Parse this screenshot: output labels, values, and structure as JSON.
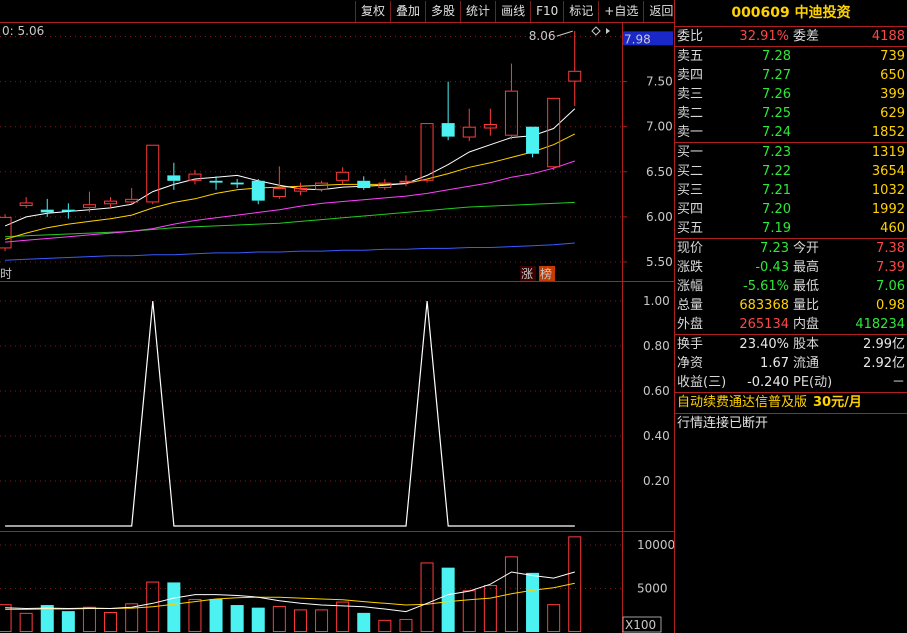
{
  "toolbar": {
    "buttons": [
      "复权",
      "叠加",
      "多股",
      "统计",
      "画线",
      "F10",
      "标记",
      "+自选",
      "返回"
    ]
  },
  "chart": {
    "ma_label": "0: 5.06",
    "price_tag": "7.98",
    "high_marker": "8.06",
    "badge_zhang": "涨",
    "badge_bang": "榜",
    "corner_char": "时",
    "vol_unit": "X100",
    "colors": {
      "up": "#ff3c3c",
      "down": "#4cf2f2",
      "ma5": "#ffffff",
      "ma10": "#ffd200",
      "ma20": "#ff40ff",
      "ma60": "#22cc22",
      "ma120": "#3b5bff",
      "grid": "#7a1d1d"
    }
  },
  "chart_data": [
    {
      "type": "candlestick",
      "title": "",
      "y_ticks": [
        "7.50",
        "7.00",
        "6.50",
        "6.00",
        "5.50"
      ],
      "ylim": [
        5.3,
        8.15
      ],
      "candles": [
        {
          "o": 5.65,
          "c": 6.0,
          "h": 6.03,
          "l": 5.62
        },
        {
          "o": 6.12,
          "c": 6.16,
          "h": 6.22,
          "l": 6.1
        },
        {
          "o": 6.08,
          "c": 6.05,
          "h": 6.2,
          "l": 6.0
        },
        {
          "o": 6.08,
          "c": 6.06,
          "h": 6.15,
          "l": 5.98
        },
        {
          "o": 6.1,
          "c": 6.14,
          "h": 6.28,
          "l": 6.05
        },
        {
          "o": 6.14,
          "c": 6.18,
          "h": 6.22,
          "l": 6.1
        },
        {
          "o": 6.16,
          "c": 6.2,
          "h": 6.32,
          "l": 6.14
        },
        {
          "o": 6.16,
          "c": 6.8,
          "h": 6.8,
          "l": 6.14
        },
        {
          "o": 6.46,
          "c": 6.4,
          "h": 6.6,
          "l": 6.3
        },
        {
          "o": 6.4,
          "c": 6.48,
          "h": 6.52,
          "l": 6.36
        },
        {
          "o": 6.4,
          "c": 6.38,
          "h": 6.45,
          "l": 6.3
        },
        {
          "o": 6.38,
          "c": 6.36,
          "h": 6.42,
          "l": 6.32
        },
        {
          "o": 6.4,
          "c": 6.18,
          "h": 6.42,
          "l": 6.14
        },
        {
          "o": 6.22,
          "c": 6.32,
          "h": 6.56,
          "l": 6.2
        },
        {
          "o": 6.28,
          "c": 6.32,
          "h": 6.38,
          "l": 6.24
        },
        {
          "o": 6.3,
          "c": 6.38,
          "h": 6.4,
          "l": 6.28
        },
        {
          "o": 6.4,
          "c": 6.5,
          "h": 6.55,
          "l": 6.36
        },
        {
          "o": 6.4,
          "c": 6.32,
          "h": 6.45,
          "l": 6.3
        },
        {
          "o": 6.32,
          "c": 6.38,
          "h": 6.42,
          "l": 6.3
        },
        {
          "o": 6.38,
          "c": 6.4,
          "h": 6.46,
          "l": 6.34
        },
        {
          "o": 6.4,
          "c": 7.04,
          "h": 7.04,
          "l": 6.38
        },
        {
          "o": 7.04,
          "c": 6.89,
          "h": 7.5,
          "l": 6.85
        },
        {
          "o": 6.88,
          "c": 7.0,
          "h": 7.2,
          "l": 6.84
        },
        {
          "o": 6.98,
          "c": 7.03,
          "h": 7.2,
          "l": 6.9
        },
        {
          "o": 6.9,
          "c": 7.4,
          "h": 7.7,
          "l": 6.86
        },
        {
          "o": 7.0,
          "c": 6.7,
          "h": 7.0,
          "l": 6.66
        },
        {
          "o": 6.55,
          "c": 7.32,
          "h": 7.32,
          "l": 6.52
        },
        {
          "o": 7.5,
          "c": 7.62,
          "h": 8.06,
          "l": 7.23
        }
      ],
      "ma5": [
        5.9,
        6.0,
        6.04,
        6.06,
        6.08,
        6.1,
        6.14,
        6.28,
        6.36,
        6.42,
        6.44,
        6.46,
        6.4,
        6.35,
        6.31,
        6.3,
        6.33,
        6.34,
        6.35,
        6.37,
        6.46,
        6.58,
        6.72,
        6.8,
        6.88,
        6.9,
        6.98,
        7.2
      ],
      "ma10": [
        5.75,
        5.82,
        5.88,
        5.92,
        5.95,
        5.98,
        6.02,
        6.1,
        6.16,
        6.2,
        6.26,
        6.3,
        6.32,
        6.33,
        6.34,
        6.35,
        6.36,
        6.36,
        6.36,
        6.37,
        6.42,
        6.48,
        6.55,
        6.6,
        6.66,
        6.72,
        6.8,
        6.92
      ],
      "ma20": [
        5.72,
        5.74,
        5.76,
        5.78,
        5.8,
        5.82,
        5.84,
        5.87,
        5.92,
        5.96,
        5.99,
        6.02,
        6.05,
        6.08,
        6.12,
        6.15,
        6.17,
        6.19,
        6.21,
        6.23,
        6.26,
        6.3,
        6.34,
        6.38,
        6.44,
        6.48,
        6.54,
        6.62
      ],
      "ma60": [
        5.78,
        5.79,
        5.8,
        5.81,
        5.82,
        5.83,
        5.84,
        5.86,
        5.88,
        5.89,
        5.9,
        5.91,
        5.92,
        5.93,
        5.95,
        5.97,
        5.99,
        6.01,
        6.03,
        6.05,
        6.07,
        6.09,
        6.11,
        6.12,
        6.13,
        6.14,
        6.15,
        6.16
      ],
      "ma120": [
        5.52,
        5.53,
        5.54,
        5.55,
        5.56,
        5.57,
        5.57,
        5.58,
        5.58,
        5.59,
        5.6,
        5.6,
        5.61,
        5.61,
        5.62,
        5.62,
        5.63,
        5.63,
        5.64,
        5.64,
        5.65,
        5.65,
        5.66,
        5.66,
        5.67,
        5.68,
        5.69,
        5.71
      ]
    },
    {
      "type": "line",
      "title": "",
      "y_ticks": [
        "1.00",
        "0.80",
        "0.60",
        "0.40",
        "0.20"
      ],
      "ylim": [
        0,
        1.0
      ],
      "values": [
        0,
        0,
        0,
        0,
        0,
        0,
        0,
        1,
        0,
        0,
        0,
        0,
        0,
        0,
        0,
        0,
        0,
        0,
        0,
        0,
        1,
        0,
        0,
        0,
        0,
        0,
        0,
        0
      ]
    },
    {
      "type": "bar",
      "title": "",
      "y_ticks": [
        "10000",
        "5000"
      ],
      "ylim": [
        0,
        11500
      ],
      "volumes": [
        3200,
        2200,
        3100,
        2400,
        2900,
        2300,
        3300,
        5800,
        5700,
        3800,
        3800,
        3100,
        2800,
        3000,
        2600,
        2600,
        3500,
        2200,
        1400,
        1500,
        8000,
        7400,
        4800,
        5400,
        8700,
        6800,
        3200,
        11000
      ],
      "vol_ma5": [
        2800,
        2700,
        2750,
        2700,
        2750,
        2700,
        2850,
        3300,
        3900,
        4300,
        4300,
        4200,
        4000,
        3600,
        3300,
        3100,
        3000,
        2900,
        2650,
        2350,
        3300,
        4300,
        4700,
        5500,
        6900,
        6500,
        6200,
        6900
      ],
      "vol_ma10": [
        2600,
        2600,
        2650,
        2650,
        2700,
        2700,
        2750,
        2900,
        3200,
        3500,
        3800,
        3950,
        4000,
        4000,
        3900,
        3800,
        3700,
        3500,
        3300,
        3100,
        3200,
        3500,
        3700,
        3900,
        4400,
        4800,
        5100,
        5600
      ]
    }
  ],
  "panel": {
    "title": "000609 中迪投资",
    "weibi": {
      "label": "委比",
      "value": "32.91%",
      "label2": "委差",
      "value2": "4188"
    },
    "sells": [
      {
        "label": "卖五",
        "price": "7.28",
        "vol": "739"
      },
      {
        "label": "卖四",
        "price": "7.27",
        "vol": "650"
      },
      {
        "label": "卖三",
        "price": "7.26",
        "vol": "399"
      },
      {
        "label": "卖二",
        "price": "7.25",
        "vol": "629"
      },
      {
        "label": "卖一",
        "price": "7.24",
        "vol": "1852"
      }
    ],
    "buys": [
      {
        "label": "买一",
        "price": "7.23",
        "vol": "1319"
      },
      {
        "label": "买二",
        "price": "7.22",
        "vol": "3654"
      },
      {
        "label": "买三",
        "price": "7.21",
        "vol": "1032"
      },
      {
        "label": "买四",
        "price": "7.20",
        "vol": "1992"
      },
      {
        "label": "买五",
        "price": "7.19",
        "vol": "460"
      }
    ],
    "quote": [
      {
        "l1": "现价",
        "v1": "7.23",
        "c1": "green",
        "l2": "今开",
        "v2": "7.38",
        "c2": "red"
      },
      {
        "l1": "涨跌",
        "v1": "-0.43",
        "c1": "green",
        "l2": "最高",
        "v2": "7.39",
        "c2": "red"
      },
      {
        "l1": "涨幅",
        "v1": "-5.61%",
        "c1": "green",
        "l2": "最低",
        "v2": "7.06",
        "c2": "green"
      },
      {
        "l1": "总量",
        "v1": "683368",
        "c1": "yellow",
        "l2": "量比",
        "v2": "0.98",
        "c2": "yellow"
      },
      {
        "l1": "外盘",
        "v1": "265134",
        "c1": "red",
        "l2": "内盘",
        "v2": "418234",
        "c2": "green"
      }
    ],
    "fund": [
      {
        "l1": "换手",
        "v1": "23.40%",
        "l2": "股本",
        "v2": "2.99亿"
      },
      {
        "l1": "净资",
        "v1": "1.67",
        "l2": "流通",
        "v2": "2.92亿"
      },
      {
        "l1": "收益(三)",
        "v1": "-0.240",
        "l2": "PE(动)",
        "v2": "－"
      }
    ],
    "ad_text": "自动续费通达信普及版",
    "ad_price": "30元/月",
    "status": "行情连接已断开"
  }
}
